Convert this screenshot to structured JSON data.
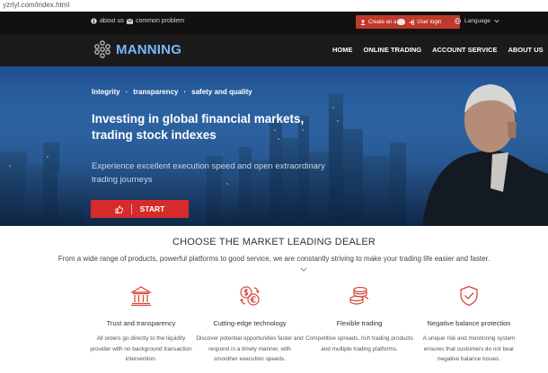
{
  "browser": {
    "url": "yzrlyl.com/index.html"
  },
  "topbar": {
    "about_label": "about us",
    "problem_label": "common problem",
    "auth_label_prefix": "Create an a",
    "auth_label_suffix": "User login",
    "language_label": "Language"
  },
  "navbar": {
    "logo_text": "MANNING",
    "links": [
      "HOME",
      "ONLINE TRADING",
      "ACCOUNT SERVICE",
      "ABOUT US"
    ]
  },
  "hero": {
    "tags": [
      "Integrity",
      "transparency",
      "safety and quality"
    ],
    "title": "Investing in global financial markets, trading stock indexes",
    "subtitle": "Experience excellent execution speed and open extraordinary trading journeys",
    "start_label": "START"
  },
  "section": {
    "title": "CHOOSE THE MARKET LEADING DEALER",
    "subtitle": "From a wide range of products, powerful platforms to good service, we are constantly striving to make your trading life easier and faster."
  },
  "features": [
    {
      "icon": "bank-icon",
      "title": "Trust and transparency",
      "desc": "All orders go directly to the liquidity provider with no background transaction intervention."
    },
    {
      "icon": "dollar-euro-exchange-icon",
      "title": "Cutting-edge technology",
      "desc": "Discover potential opportunities faster and respond in a timely manner, with smoother execution speeds."
    },
    {
      "icon": "coin-stack-icon",
      "title": "Flexible trading",
      "desc": "Competitive spreads, rich trading products and multiple trading platforms."
    },
    {
      "icon": "shield-check-icon",
      "title": "Negative balance protection",
      "desc": "A unique risk and monitoring system ensures that customers do not bear negative balance losses."
    }
  ],
  "colors": {
    "accent_red": "#d52b2b",
    "logo_blue": "#79b8ff",
    "nav_dark": "#1b1b1b",
    "icon_red": "#d9483b"
  }
}
